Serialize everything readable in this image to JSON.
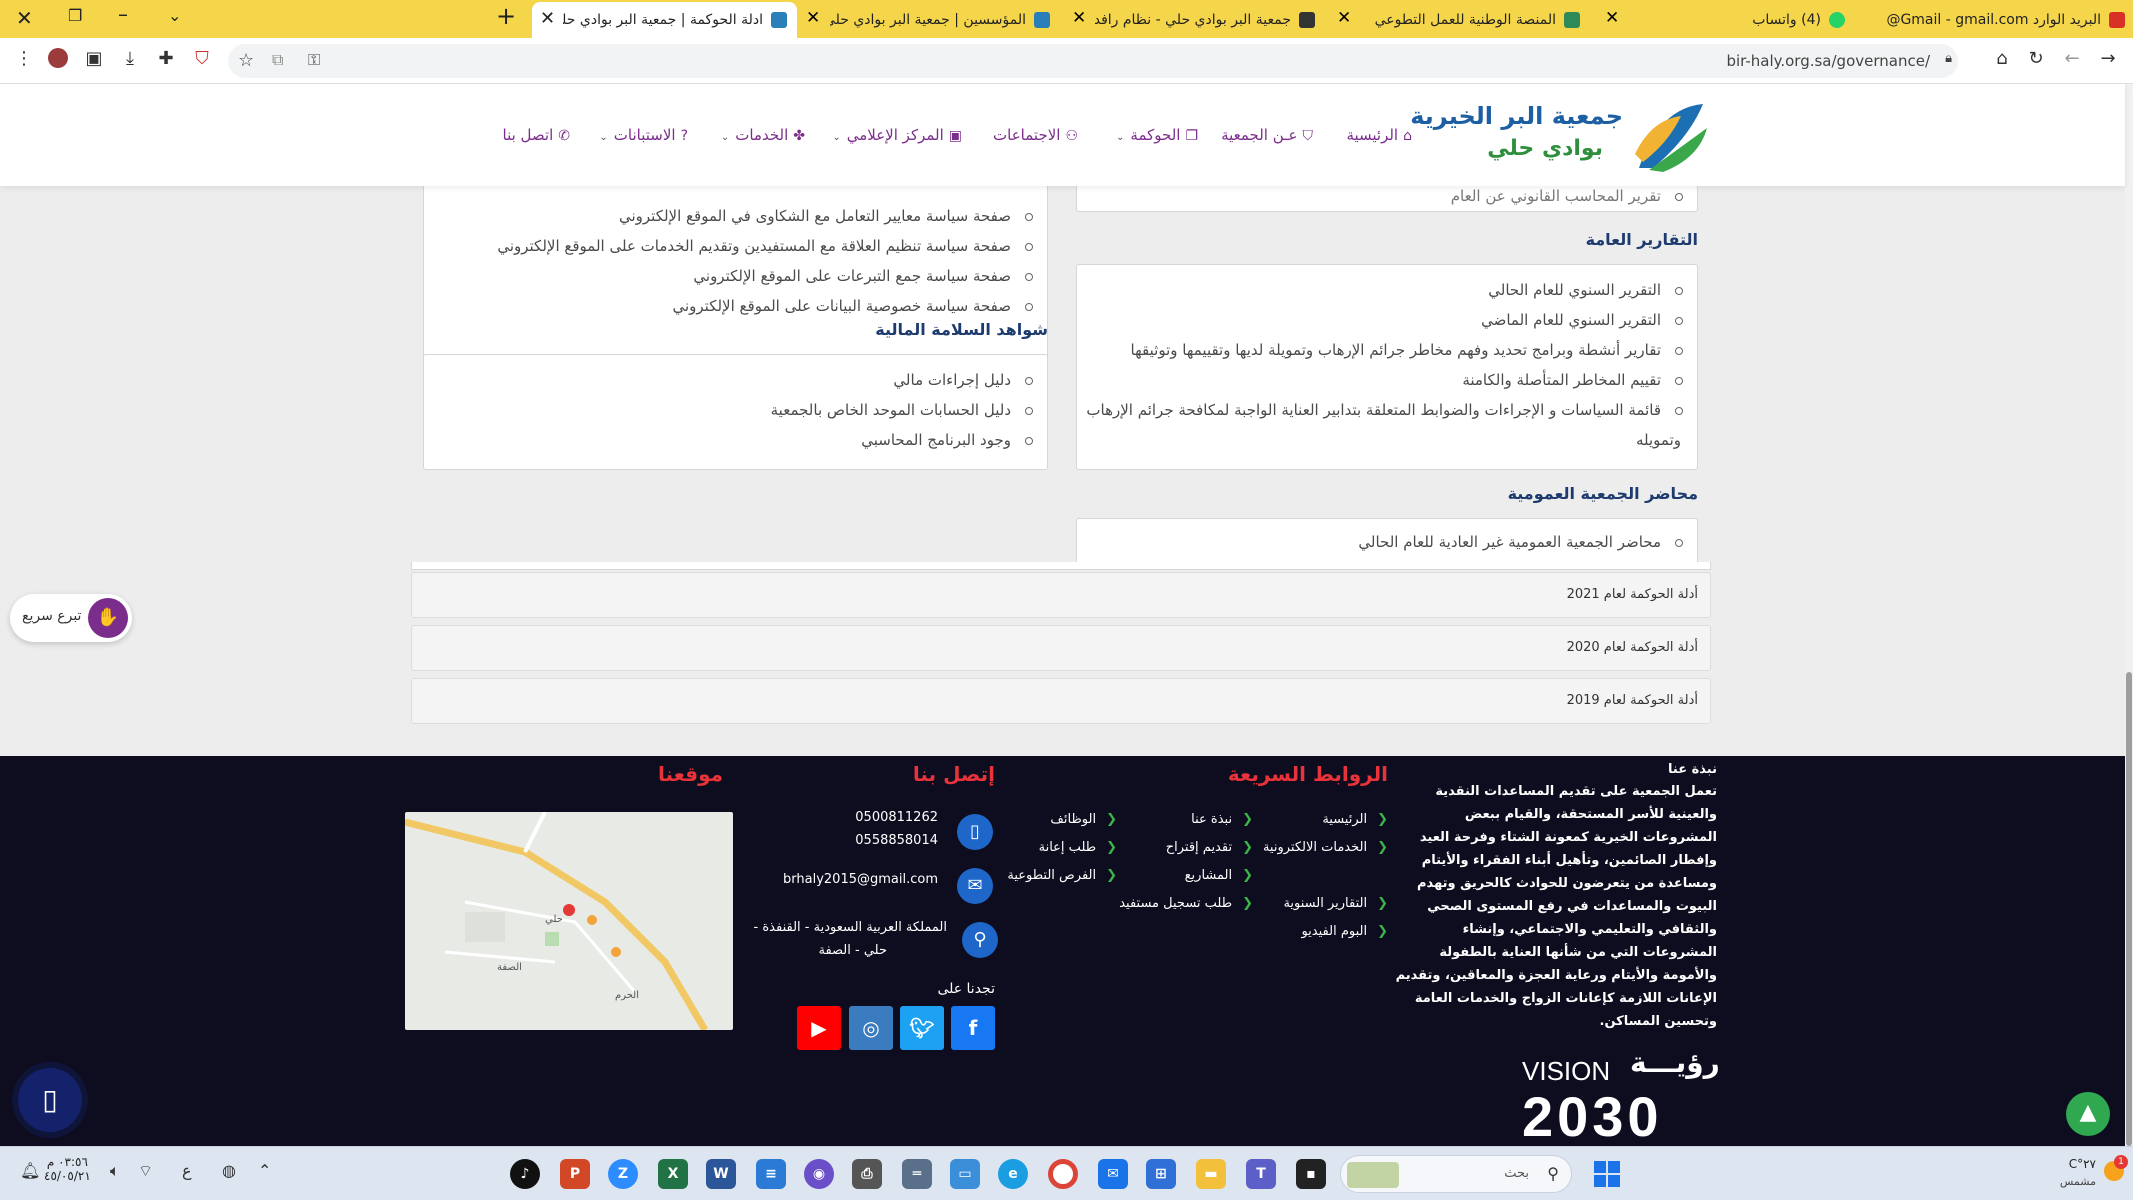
{
  "browser": {
    "tabs": [
      {
        "title": "البريد الوارد Gmail - gmail.com@",
        "favicon_color": "#d93025"
      },
      {
        "title": "(4) واتساب",
        "favicon_color": "#25d366"
      },
      {
        "title": "المنصة الوطنية للعمل التطوعي",
        "favicon_color": "#2e8b57"
      },
      {
        "title": "جمعية البر بوادي حلي - نظام رافد",
        "favicon_color": "#333333"
      },
      {
        "title": "المؤسسين | جمعية البر بوادي حلي",
        "favicon_color": "#2a7fb8"
      },
      {
        "title": "ادلة الحوكمة | جمعية البر بوادي حلي",
        "favicon_color": "#2a7fb8"
      }
    ],
    "new_tab": "+",
    "url": "bir-haly.org.sa/governance/"
  },
  "site": {
    "logo_line1": "جمعية البر الخيرية",
    "logo_line2": "بوادي حلي",
    "nav": [
      {
        "label": "الرئيسية",
        "icon": "home-icon",
        "dropdown": false
      },
      {
        "label": "عـن الجمعية",
        "icon": "bookmark-icon",
        "dropdown": false
      },
      {
        "label": "الحوكمة",
        "icon": "copy-icon",
        "dropdown": true
      },
      {
        "label": "الاجتماعات",
        "icon": "users-icon",
        "dropdown": false
      },
      {
        "label": "المركز الإعلامي",
        "icon": "camera-icon",
        "dropdown": true
      },
      {
        "label": "الخدمات",
        "icon": "services-icon",
        "dropdown": true
      },
      {
        "label": "الاستبانات",
        "icon": "question-icon",
        "dropdown": true
      },
      {
        "label": "اتصل بنا",
        "icon": "phone-icon",
        "dropdown": false
      }
    ]
  },
  "content": {
    "right_top_partial": "تقرير المحاسب القانوني عن العام",
    "left_top_items": [
      "صفحة سياسة معايير التعامل مع الشكاوى في الموقع الإلكتروني",
      "صفحة سياسة تنظيم العلاقة مع المستفيدين وتقديم الخدمات على الموقع الإلكتروني",
      "صفحة سياسة جمع التبرعات على الموقع الإلكتروني",
      "صفحة سياسة خصوصية البيانات على الموقع الإلكتروني"
    ],
    "general_reports_title": "التقارير العامة",
    "general_reports": [
      "التقرير السنوي للعام الحالي",
      "التقرير السنوي للعام الماضي",
      "تقارير أنشطة وبرامج تحديد وفهم مخاطر جرائم الإرهاب وتمويلة لديها وتقييمها وتوثيقها",
      "تقييم المخاطر المتأصلة والكامنة",
      "قائمة السياسات و الإجراءات والضوابط المتعلقة بتدابير العناية الواجبة لمكافحة جرائم الإرهاب"
    ],
    "general_reports_wrap": "وتمويله",
    "financial_title": "شواهد السلامة المالية",
    "financial_items": [
      "دليل إجراءات مالي",
      "دليل الحسابات الموحد الخاص بالجمعية",
      "وجود البرنامج المحاسبي"
    ],
    "assembly_title": "محاضر الجمعية العمومية",
    "assembly_items": [
      "محاضر الجمعية العمومية غير العادية للعام الحالي"
    ],
    "accordions": [
      "أدلة الحوكمة لعام 2021",
      "أدلة الحوكمة لعام 2020",
      "أدلة الحوكمة لعام 2019"
    ],
    "quick_donate": "تبرع سريع"
  },
  "footer": {
    "about_title": "نبذة عنا",
    "about_text": "تعمل الجمعية على تقديم المساعدات النقدية والعينية للأسر المستحقة، والقيام ببعض المشروعات الخيرية كمعونة الشتاء وفرحة العيد وإفطار الصائمين، وتأهيل أبناء الفقراء والأيتام ومساعدة من يتعرضون للحوادث كالحريق وتهدم البيوت والمساعدات في رفع المستوى الصحي والثقافي والتعليمي والاجتماعي، وإنشاء المشروعات التي من شأنها العناية بالطفولة والأمومة والأيتام ورعاية العجزة والمعاقين، وتقديم الإعانات اللازمة كإعانات الزواج والخدمات العامة وتحسين المساكن.",
    "quick_links_title": "الروابط السريعة",
    "quick_links_col1": [
      "الرئيسية",
      "الخدمات الالكترونية",
      "التقارير السنوية",
      "البوم الفيديو"
    ],
    "quick_links_col2": [
      "نبذة عنا",
      "تقديم إقتراح",
      "المشاريع",
      "طلب تسجيل مستفيد"
    ],
    "quick_links_col3": [
      "الوظائف",
      "طلب إعانة",
      "الفرص التطوعية"
    ],
    "contact_title": "إتصل بنا",
    "phone1": "0500811262",
    "phone2": "0558858014",
    "email": "brhaly2015@gmail.com",
    "address_line1": "المملكة العربية السعودية - القنفذة -",
    "address_line2": "حلي - الصفة",
    "follow_us": "تجدنا على",
    "location_title": "موقعنا",
    "map_labels": [
      "حلي",
      "الصفة",
      "الحرم"
    ],
    "vision_word_ar": "رؤيـــة",
    "vision_word_en": "VISION",
    "vision_year": "2030"
  },
  "taskbar": {
    "search_placeholder": "بحث",
    "weather": "٢٧°C",
    "weather_desc": "مشمس",
    "time": "٠٣:٥٦ م",
    "date": "٤٥/٠٥/٢١",
    "lang": "ع"
  }
}
